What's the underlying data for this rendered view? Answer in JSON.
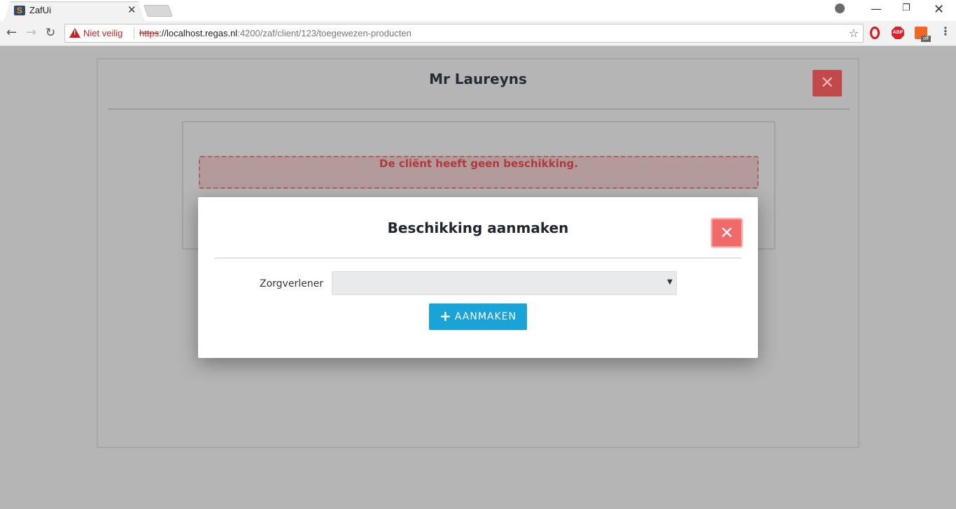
{
  "browser": {
    "tab_title": "ZafUi",
    "tab_close_glyph": "✕",
    "security_label": "Niet veilig",
    "url_scheme": "https",
    "url_host": "://localhost.regas.nl",
    "url_rest": ":4200/zaf/client/123/toegewezen-producten",
    "ext_abp_label": "ABP",
    "ext_off_label": "off"
  },
  "page": {
    "client_title": "Mr Laureyns",
    "alert_text": "De cliënt heeft geen beschikking."
  },
  "modal": {
    "title": "Beschikking aanmaken",
    "field_label": "Zorgverlener",
    "select_value": "",
    "submit_label": "AANMAKEN"
  },
  "colors": {
    "backdrop": "#b5b5b5",
    "close_button": "#f06a6a",
    "primary_button": "#1aa3d6",
    "alert_text": "#b0393e"
  },
  "icons": {
    "back": "arrow-left-icon",
    "forward": "arrow-right-icon",
    "reload": "reload-icon",
    "warning": "warning-icon",
    "star": "star-icon",
    "close": "close-icon",
    "plus": "plus-icon",
    "dropdown": "caret-down-icon"
  }
}
